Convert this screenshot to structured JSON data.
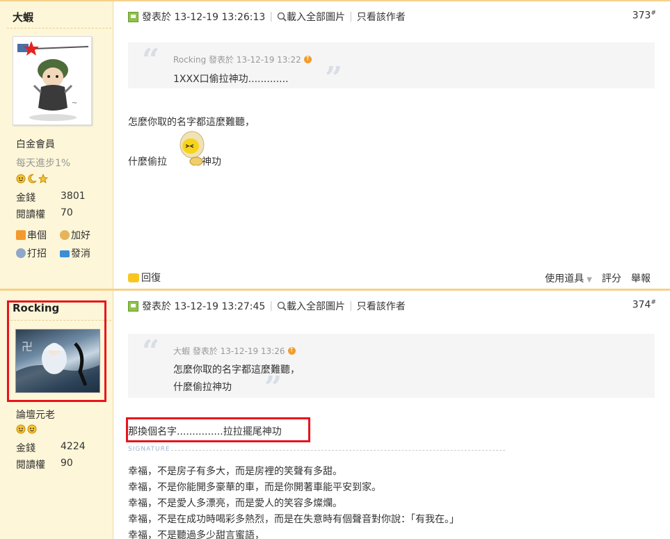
{
  "post1": {
    "author": "大蝦",
    "rank": "白金會員",
    "rank_subtitle": "每天進步1%",
    "money_label": "金錢",
    "money_value": "3801",
    "read_label": "閱讀權",
    "read_value": "70",
    "links": [
      "串個",
      "加好",
      "打招",
      "發消"
    ],
    "posted_at": "發表於  13-12-19 13:26:13",
    "load_images": "載入全部圖片",
    "only_author": "只看該作者",
    "floor": "373",
    "floor_mark": "#",
    "quote_meta": "Rocking 發表於  13-12-19 13:22",
    "quote_text": "1XXX口偷拉神功.............",
    "line1": "怎麼你取的名字都這麼難聽，",
    "line2a": "什麼偷拉",
    "line2b": "神功",
    "reply": "回復",
    "use_tool": "使用道具",
    "rate": "評分",
    "report": "舉報"
  },
  "post2": {
    "author": "Rocking",
    "rank": "論壇元老",
    "money_label": "金錢",
    "money_value": "4224",
    "read_label": "閱讀權",
    "read_value": "90",
    "posted_at": "發表於  13-12-19 13:27:45",
    "load_images": "載入全部圖片",
    "only_author": "只看該作者",
    "floor": "374",
    "floor_mark": "#",
    "quote_meta": "大蝦 發表於  13-12-19 13:26",
    "quote_line1": "怎麼你取的名字都這麼難聽，",
    "quote_line2": "什麼偷拉神功",
    "main_text": "那換個名字...............拉拉擺尾神功",
    "signature_label": "SIGNATURE",
    "sig_lines": [
      "幸福，不是房子有多大，而是房裡的笑聲有多甜。",
      "幸福，不是你能開多豪華的車，而是你開著車能平安到家。",
      "幸福，不是愛人多漂亮，而是愛人的笑容多燦爛。",
      "幸福，不是在成功時喝彩多熱烈，而是在失意時有個聲音對你說：「有我在。」",
      "幸福，不是聽過多少甜言蜜語，"
    ]
  },
  "colors": {
    "sidebar_bg": "#fdf6d8",
    "top_border": "#f5d089",
    "highlight_red": "#e8141c",
    "quote_bg": "#f5f5f5"
  }
}
